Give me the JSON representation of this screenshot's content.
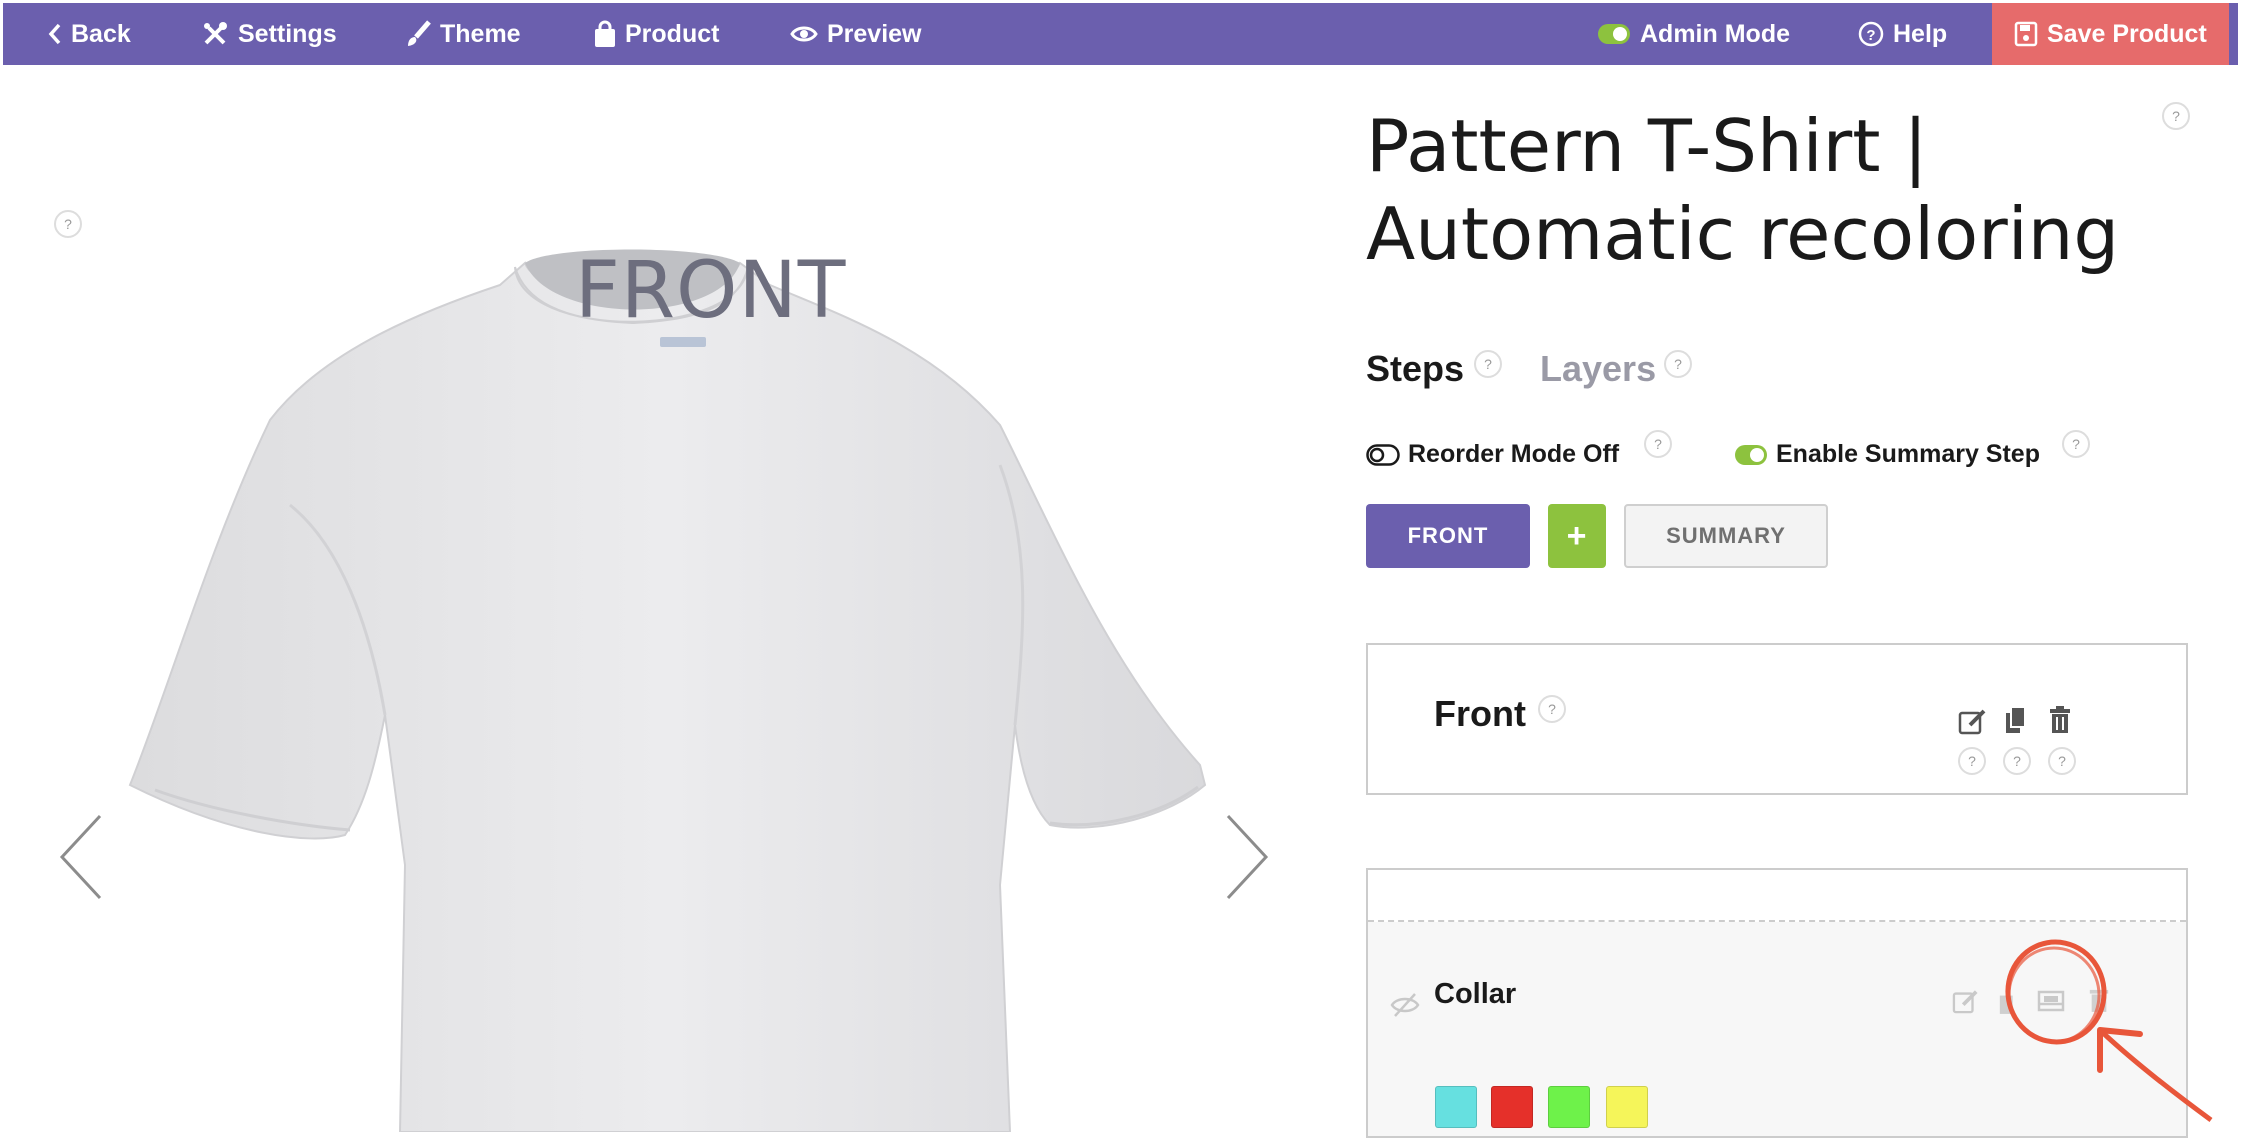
{
  "topbar": {
    "back": "Back",
    "settings": "Settings",
    "theme": "Theme",
    "product": "Product",
    "preview": "Preview",
    "admin_mode": "Admin Mode",
    "help": "Help",
    "save": "Save Product"
  },
  "canvas": {
    "view_label": "FRONT",
    "help": "?"
  },
  "product": {
    "title": "Pattern T-Shirt | Automatic recoloring",
    "help": "?"
  },
  "tabs": [
    {
      "label": "Steps",
      "active": true
    },
    {
      "label": "Layers",
      "active": false
    }
  ],
  "toggles": {
    "reorder": {
      "label": "Reorder Mode Off",
      "on": false
    },
    "summary": {
      "label": "Enable Summary Step",
      "on": true
    }
  },
  "step_buttons": {
    "front": "FRONT",
    "add": "+",
    "summary": "SUMMARY"
  },
  "step_panel": {
    "title": "Front",
    "help": "?"
  },
  "layer": {
    "name": "Collar",
    "swatches": [
      "#66e0e0",
      "#e5302a",
      "#6ef24a",
      "#f5f55a"
    ]
  },
  "colors": {
    "brand": "#6b5fae",
    "save": "#e66b6b",
    "add": "#8dc23e",
    "annotation": "#e8563a"
  }
}
